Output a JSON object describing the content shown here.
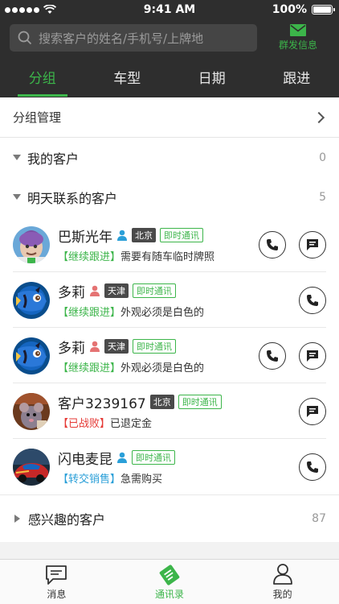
{
  "status_bar": {
    "time": "9:41 AM",
    "battery": "100%",
    "battery_level": 1.0
  },
  "search": {
    "placeholder": "搜索客户的姓名/手机号/上牌地"
  },
  "bulk_message": {
    "label": "群发信息",
    "icon": "mail-icon"
  },
  "tabs": [
    {
      "label": "分组",
      "active": true
    },
    {
      "label": "车型",
      "active": false
    },
    {
      "label": "日期",
      "active": false
    },
    {
      "label": "跟进",
      "active": false
    }
  ],
  "group_management": {
    "label": "分组管理"
  },
  "groups": {
    "my_customers": {
      "title": "我的客户",
      "count": "0"
    },
    "tomorrow": {
      "title": "明天联系的客户",
      "count": "5"
    },
    "interested": {
      "title": "感兴趣的客户",
      "count": "87"
    }
  },
  "customers": [
    {
      "name": "巴斯光年",
      "gender": "male",
      "city": "北京",
      "im": "即时通讯",
      "status": "【继续跟进】",
      "status_color": "#3cb54a",
      "note": "需要有随车临时牌照",
      "call": true,
      "chat": true,
      "avatar": "buzz-avatar"
    },
    {
      "name": "多莉",
      "gender": "female",
      "city": "天津",
      "im": "即时通讯",
      "status": "【继续跟进】",
      "status_color": "#3cb54a",
      "note": "外观必须是白色的",
      "call": true,
      "chat": false,
      "avatar": "fish-avatar"
    },
    {
      "name": "多莉",
      "gender": "female",
      "city": "天津",
      "im": "即时通讯",
      "status": "【继续跟进】",
      "status_color": "#3cb54a",
      "note": "外观必须是白色的",
      "call": true,
      "chat": true,
      "avatar": "fish-avatar"
    },
    {
      "name": "客户3239167",
      "gender": "",
      "city": "北京",
      "im": "即时通讯",
      "status": "【已战败】",
      "status_color": "#e53935",
      "note": "已退定金",
      "call": false,
      "chat": true,
      "avatar": "rat-avatar"
    },
    {
      "name": "闪电麦昆",
      "gender": "male",
      "city": "",
      "im": "即时通讯",
      "status": "【转交销售】",
      "status_color": "#2a9fd8",
      "note": "急需购买",
      "call": true,
      "chat": false,
      "avatar": "car-avatar"
    }
  ],
  "tabbar": [
    {
      "label": "消息",
      "icon": "message-icon",
      "active": false
    },
    {
      "label": "通讯录",
      "icon": "contacts-icon",
      "active": true
    },
    {
      "label": "我的",
      "icon": "profile-icon",
      "active": false
    }
  ],
  "colors": {
    "accent": "#3cb54a",
    "header_bg": "#2e2e2e",
    "male": "#2a9fd8",
    "female": "#e57373"
  }
}
